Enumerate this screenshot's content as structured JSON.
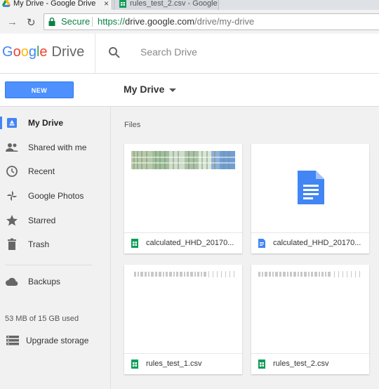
{
  "browser": {
    "tabs": [
      {
        "title": "My Drive - Google Drive",
        "active": true
      },
      {
        "title": "rules_test_2.csv - Google",
        "active": false
      }
    ],
    "address": {
      "secure_label": "Secure",
      "url_protocol": "https://",
      "url_host": "drive.google.com",
      "url_path": "/drive/my-drive"
    }
  },
  "header": {
    "logo_google": "Google",
    "logo_product": "Drive",
    "search_placeholder": "Search Drive"
  },
  "toolbar": {
    "new_label": "NEW",
    "breadcrumb": "My Drive"
  },
  "sidebar": {
    "items": [
      {
        "label": "My Drive",
        "icon": "my-drive-icon",
        "active": true
      },
      {
        "label": "Shared with me",
        "icon": "people-icon"
      },
      {
        "label": "Recent",
        "icon": "clock-icon"
      },
      {
        "label": "Google Photos",
        "icon": "pinwheel-icon"
      },
      {
        "label": "Starred",
        "icon": "star-icon"
      },
      {
        "label": "Trash",
        "icon": "trash-icon"
      },
      {
        "label": "Backups",
        "icon": "cloud-icon"
      }
    ],
    "storage_text": "53 MB of 15 GB used",
    "upgrade_label": "Upgrade storage"
  },
  "main": {
    "section_title": "Files",
    "files": [
      {
        "name": "calculated_HHD_20170...",
        "type": "sheet"
      },
      {
        "name": "calculated_HHD_20170...",
        "type": "doc"
      },
      {
        "name": "rules_test_1.csv",
        "type": "sheet"
      },
      {
        "name": "rules_test_2.csv",
        "type": "sheet"
      }
    ]
  },
  "colors": {
    "accent": "#4285f4",
    "new_button": "#4d90fe",
    "sheet_green": "#0f9d58",
    "doc_blue": "#4285f4",
    "secure_green": "#0b8043"
  }
}
